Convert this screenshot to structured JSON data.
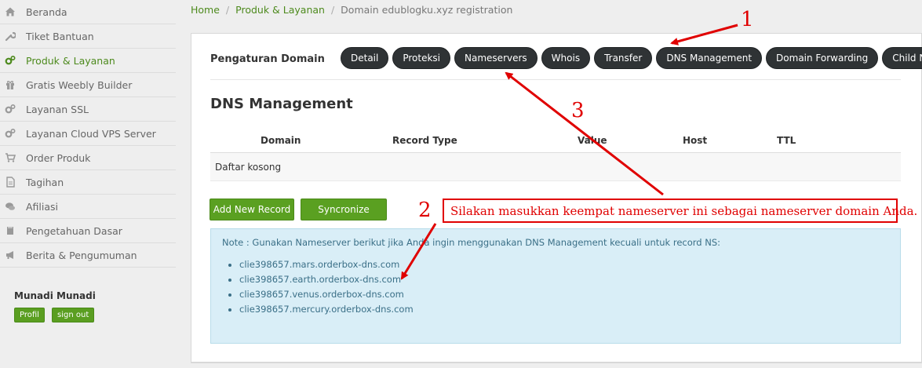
{
  "sidebar": {
    "items": [
      {
        "label": "Beranda",
        "icon": "home-icon"
      },
      {
        "label": "Tiket Bantuan",
        "icon": "wrench-icon"
      },
      {
        "label": "Produk & Layanan",
        "icon": "cogs-icon",
        "active": true
      },
      {
        "label": "Gratis Weebly Builder",
        "icon": "gift-icon"
      },
      {
        "label": "Layanan SSL",
        "icon": "cogs-icon"
      },
      {
        "label": "Layanan Cloud VPS Server",
        "icon": "cogs-icon"
      },
      {
        "label": "Order Produk",
        "icon": "cart-icon"
      },
      {
        "label": "Tagihan",
        "icon": "document-icon"
      },
      {
        "label": "Afiliasi",
        "icon": "chat-icon"
      },
      {
        "label": "Pengetahuan Dasar",
        "icon": "book-icon"
      },
      {
        "label": "Berita & Pengumuman",
        "icon": "megaphone-icon"
      }
    ],
    "user": {
      "name": "Munadi Munadi",
      "profile_label": "Profil",
      "signout_label": "sign out"
    }
  },
  "breadcrumb": {
    "home": "Home",
    "produk": "Produk & Layanan",
    "current": "Domain edublogku.xyz registration"
  },
  "panel": {
    "title": "Pengaturan Domain",
    "tabs": [
      "Detail",
      "Proteksi",
      "Nameservers",
      "Whois",
      "Transfer",
      "DNS Management",
      "Domain Forwarding",
      "Child Name"
    ],
    "section_title": "DNS Management",
    "table": {
      "headers": [
        "Domain",
        "Record Type",
        "Value",
        "Host",
        "TTL"
      ],
      "empty_text": "Daftar kosong"
    },
    "add_record_label": "Add New Record",
    "sync_label": "Syncronize",
    "note": {
      "text": "Note : Gunakan Nameserver berikut jika Anda ingin menggunakan DNS Management kecuali untuk record NS:",
      "nameservers": [
        "clie398657.mars.orderbox-dns.com",
        "clie398657.earth.orderbox-dns.com",
        "clie398657.venus.orderbox-dns.com",
        "clie398657.mercury.orderbox-dns.com"
      ]
    }
  },
  "annotations": {
    "callout": "Silakan masukkan keempat nameserver ini sebagai nameserver domain Anda.",
    "num1": "1",
    "num2": "2",
    "num3": "3",
    "color": "#e00000"
  },
  "colors": {
    "accent_green": "#5aa021",
    "tab_dark": "#2f3335",
    "note_bg": "#d9eef7"
  }
}
